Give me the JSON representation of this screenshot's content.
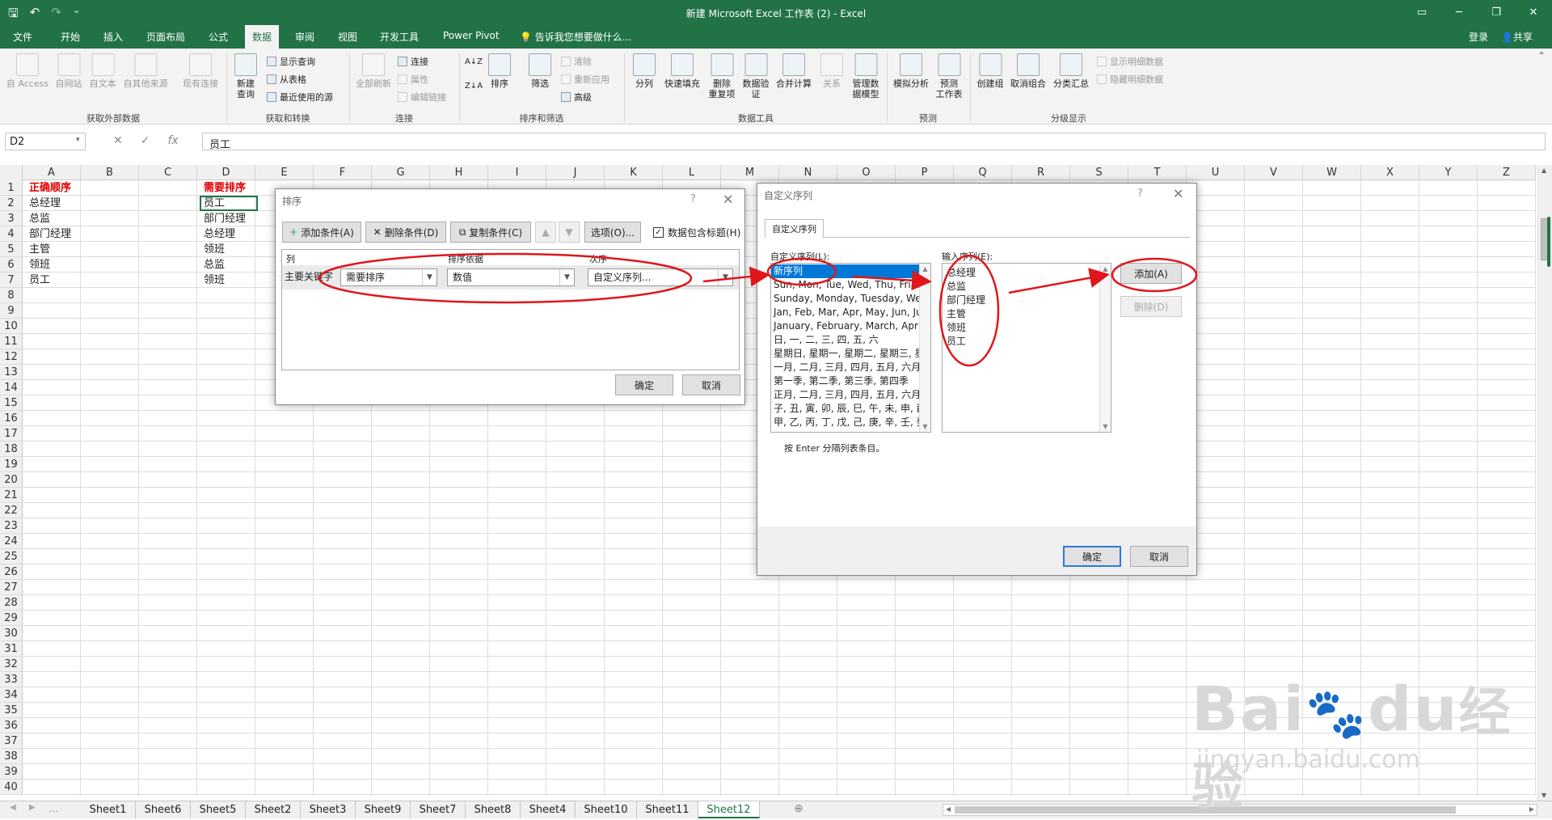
{
  "window": {
    "title": "新建 Microsoft Excel 工作表 (2) - Excel"
  },
  "tabs": [
    "文件",
    "开始",
    "插入",
    "页面布局",
    "公式",
    "数据",
    "审阅",
    "视图",
    "开发工具",
    "Power Pivot"
  ],
  "active_tab": "数据",
  "tell_me": "告诉我您想要做什么...",
  "account": {
    "login": "登录",
    "share": "共享"
  },
  "ribbon": {
    "groups": {
      "external": "获取外部数据",
      "transform": "获取和转换",
      "connections": "连接",
      "sort_filter": "排序和筛选",
      "data_tools": "数据工具",
      "forecast": "预测",
      "outline": "分级显示"
    },
    "buttons": {
      "access": "自 Access",
      "web": "自网站",
      "text": "自文本",
      "other": "自其他来源",
      "existing": "现有连接",
      "new_query": "新建\n查询",
      "show_query": "显示查询",
      "from_table": "从表格",
      "recent_src": "最近使用的源",
      "refresh_all": "全部刷新",
      "conn": "连接",
      "props": "属性",
      "edit_links": "编辑链接",
      "sort": "排序",
      "filter": "筛选",
      "clear": "清除",
      "reapply": "重新应用",
      "advanced": "高级",
      "text_to_col": "分列",
      "flash_fill": "快速填充",
      "remove_dup": "删除\n重复项",
      "validation": "数据验\n证",
      "consolidate": "合并计算",
      "relations": "关系",
      "data_model": "管理数\n据模型",
      "what_if": "模拟分析",
      "forecast_sheet": "预测\n工作表",
      "group": "创建组",
      "ungroup": "取消组合",
      "subtotal": "分类汇总",
      "show_detail": "显示明细数据",
      "hide_detail": "隐藏明细数据"
    }
  },
  "formula_bar": {
    "name_box": "D2",
    "value": "员工"
  },
  "columns": [
    "A",
    "B",
    "C",
    "D",
    "E",
    "F",
    "G",
    "H",
    "I",
    "J",
    "K",
    "L",
    "M",
    "N",
    "O",
    "P",
    "Q",
    "R",
    "S",
    "T",
    "U",
    "V",
    "W",
    "X",
    "Y",
    "Z"
  ],
  "rows": [
    "1",
    "2",
    "3",
    "4",
    "5",
    "6",
    "7",
    "8",
    "9",
    "10",
    "11",
    "12",
    "13",
    "14",
    "15",
    "16",
    "17",
    "18",
    "19",
    "20",
    "21",
    "22",
    "23",
    "24",
    "25",
    "26",
    "27",
    "28",
    "29",
    "30",
    "31",
    "32",
    "33",
    "34",
    "35",
    "36",
    "37",
    "38",
    "39",
    "40"
  ],
  "cells": {
    "A": [
      "正确顺序",
      "总经理",
      "总监",
      "部门经理",
      "主管",
      "领班",
      "员工"
    ],
    "D": [
      "需要排序",
      "员工",
      "部门经理",
      "总经理",
      "领班",
      "总监",
      "领班"
    ]
  },
  "sheets": [
    "Sheet1",
    "Sheet6",
    "Sheet5",
    "Sheet2",
    "Sheet3",
    "Sheet9",
    "Sheet7",
    "Sheet8",
    "Sheet4",
    "Sheet10",
    "Sheet11",
    "Sheet12"
  ],
  "active_sheet": "Sheet12",
  "sort_dialog": {
    "title": "排序",
    "add": "添加条件(A)",
    "delete": "删除条件(D)",
    "copy": "复制条件(C)",
    "options": "选项(O)...",
    "has_header": "数据包含标题(H)",
    "col_header": "列",
    "sorton_header": "排序依据",
    "order_header": "次序",
    "row_label": "主要关键字",
    "column": "需要排序",
    "sort_on": "数值",
    "order": "自定义序列...",
    "ok": "确定",
    "cancel": "取消"
  },
  "custom_dialog": {
    "title": "自定义序列",
    "tab": "自定义序列",
    "lists_label": "自定义序列(L):",
    "entries_label": "输入序列(E):",
    "lists": [
      "新序列",
      "Sun, Mon, Tue, Wed, Thu, Fri, Sat",
      "Sunday, Monday, Tuesday, Wednesday",
      "Jan, Feb, Mar, Apr, May, Jun, Jul",
      "January, February, March, April",
      "日, 一, 二, 三, 四, 五, 六",
      "星期日, 星期一, 星期二, 星期三, 星期四",
      "一月, 二月, 三月, 四月, 五月, 六月, 七月",
      "第一季, 第二季, 第三季, 第四季",
      "正月, 二月, 三月, 四月, 五月, 六月, 七月",
      "子, 丑, 寅, 卯, 辰, 巳, 午, 未, 申, 酉",
      "甲, 乙, 丙, 丁, 戊, 己, 庚, 辛, 壬, 癸"
    ],
    "entries": [
      "总经理",
      "总监",
      "部门经理",
      "主管",
      "领班",
      "员工"
    ],
    "add": "添加(A)",
    "delete": "删除(D)",
    "hint": "按 Enter 分隔列表条目。",
    "ok": "确定",
    "cancel": "取消"
  },
  "watermark": {
    "brand": "Bai",
    "brand2": "du",
    "cn": "经验",
    "url": "jingyan.baidu.com"
  },
  "colors": {
    "excel_green": "#217346",
    "annotation_red": "#e0161b",
    "selection_blue": "#0078d7"
  }
}
